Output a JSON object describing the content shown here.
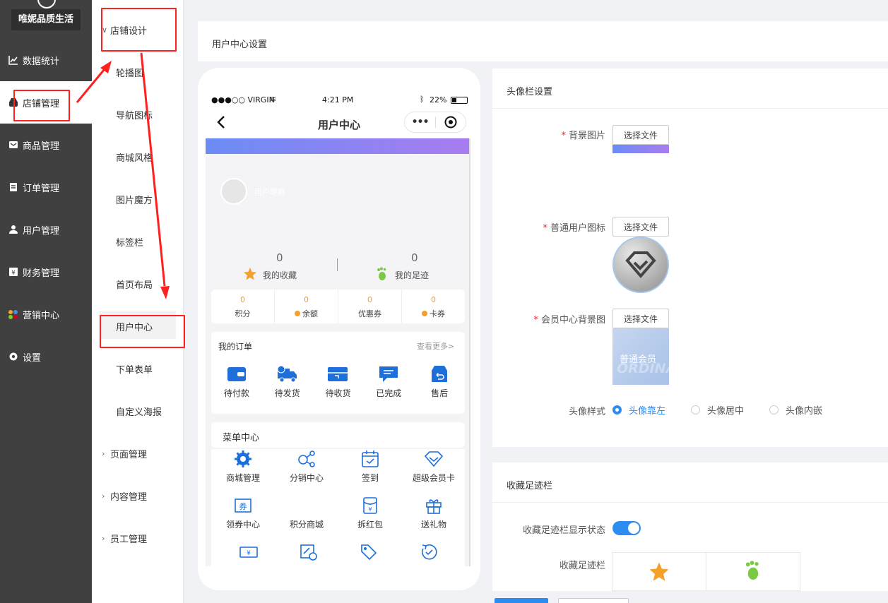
{
  "nav": {
    "brand": "唯妮品质生活",
    "items": [
      {
        "label": "数据统计",
        "icon": "chart-icon"
      },
      {
        "label": "店铺管理",
        "icon": "store-icon",
        "active": true
      },
      {
        "label": "商品管理",
        "icon": "goods-icon"
      },
      {
        "label": "订单管理",
        "icon": "order-icon"
      },
      {
        "label": "用户管理",
        "icon": "user-icon"
      },
      {
        "label": "财务管理",
        "icon": "finance-icon"
      },
      {
        "label": "营销中心",
        "icon": "marketing-icon"
      },
      {
        "label": "设置",
        "icon": "gear-icon"
      }
    ]
  },
  "subnav": {
    "group_open": "店铺设计",
    "children": [
      "轮播图",
      "导航图标",
      "商城风格",
      "图片魔方",
      "标签栏",
      "首页布局",
      "用户中心",
      "下单表单",
      "自定义海报"
    ],
    "groups": [
      "页面管理",
      "内容管理",
      "员工管理"
    ]
  },
  "header": {
    "title": "用户中心设置"
  },
  "phone": {
    "carrier": "●●●○○ VIRGIN",
    "time": "4:21 PM",
    "battery": "22%",
    "title": "用户中心",
    "nickname": "用户昵称",
    "favorites": {
      "count": "0",
      "label": "我的收藏"
    },
    "footprints": {
      "count": "0",
      "label": "我的足迹"
    },
    "assets": [
      {
        "value": "0",
        "label": "积分"
      },
      {
        "value": "0",
        "label": "余额"
      },
      {
        "value": "0",
        "label": "优惠券"
      },
      {
        "value": "0",
        "label": "卡券"
      }
    ],
    "orders": {
      "title": "我的订单",
      "more": "查看更多>",
      "items": [
        "待付款",
        "待发货",
        "待收货",
        "已完成",
        "售后"
      ]
    },
    "menu": {
      "title": "菜单中心",
      "row1": [
        "商城管理",
        "分销中心",
        "签到",
        "超级会员卡"
      ],
      "row2": [
        "领券中心",
        "积分商城",
        "拆红包",
        "送礼物"
      ]
    }
  },
  "avatar_settings": {
    "title": "头像栏设置",
    "bg_label": "背景图片",
    "user_icon_label": "普通用户图标",
    "member_bg_label": "会员中心背景图",
    "file_button": "选择文件",
    "member_card_text": "普通会员",
    "member_card_watermark": "ORDINAR",
    "style_label": "头像样式",
    "style_options": [
      "头像靠左",
      "头像居中",
      "头像内嵌"
    ],
    "style_selected": 0
  },
  "fav_settings": {
    "title": "收藏足迹栏",
    "toggle_label": "收藏足迹栏显示状态",
    "toggle_on": true,
    "bar_label": "收藏足迹栏"
  },
  "colors": {
    "accent": "#2d8cf0",
    "nav_bg": "#404040",
    "highlight_red": "#ff2020",
    "gradient_start": "#6b8cf5",
    "gradient_end": "#a87cf0"
  }
}
